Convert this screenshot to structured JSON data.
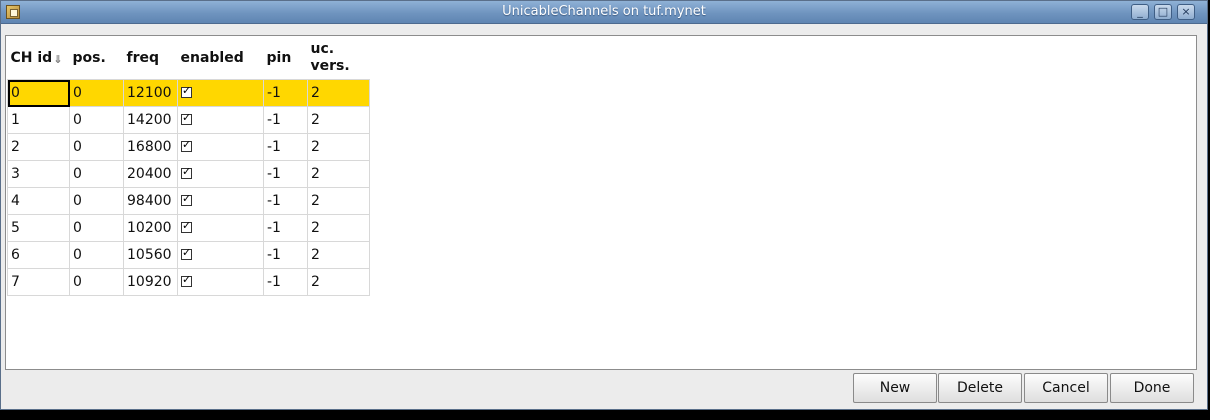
{
  "window": {
    "title": "UnicableChannels on tuf.mynet"
  },
  "window_controls": [
    "_",
    "□",
    "×"
  ],
  "table": {
    "headers": {
      "ch_id": "CH id",
      "pos": "pos.",
      "freq": "freq",
      "enabled": "enabled",
      "pin": "pin",
      "uc_vers_line1": "uc.",
      "uc_vers_line2": "vers."
    },
    "rows": [
      {
        "ch_id": "0",
        "pos": "0",
        "freq": "12100",
        "enabled": true,
        "pin": "-1",
        "uc_vers": "2"
      },
      {
        "ch_id": "1",
        "pos": "0",
        "freq": "14200",
        "enabled": true,
        "pin": "-1",
        "uc_vers": "2"
      },
      {
        "ch_id": "2",
        "pos": "0",
        "freq": "16800",
        "enabled": true,
        "pin": "-1",
        "uc_vers": "2"
      },
      {
        "ch_id": "3",
        "pos": "0",
        "freq": "20400",
        "enabled": true,
        "pin": "-1",
        "uc_vers": "2"
      },
      {
        "ch_id": "4",
        "pos": "0",
        "freq": "98400",
        "enabled": true,
        "pin": "-1",
        "uc_vers": "2"
      },
      {
        "ch_id": "5",
        "pos": "0",
        "freq": "10200",
        "enabled": true,
        "pin": "-1",
        "uc_vers": "2"
      },
      {
        "ch_id": "6",
        "pos": "0",
        "freq": "10560",
        "enabled": true,
        "pin": "-1",
        "uc_vers": "2"
      },
      {
        "ch_id": "7",
        "pos": "0",
        "freq": "10920",
        "enabled": true,
        "pin": "-1",
        "uc_vers": "2"
      }
    ],
    "selected_row": 0,
    "selection_color": "#ffd700"
  },
  "buttons": {
    "new": "New",
    "delete": "Delete",
    "cancel": "Cancel",
    "done": "Done"
  }
}
